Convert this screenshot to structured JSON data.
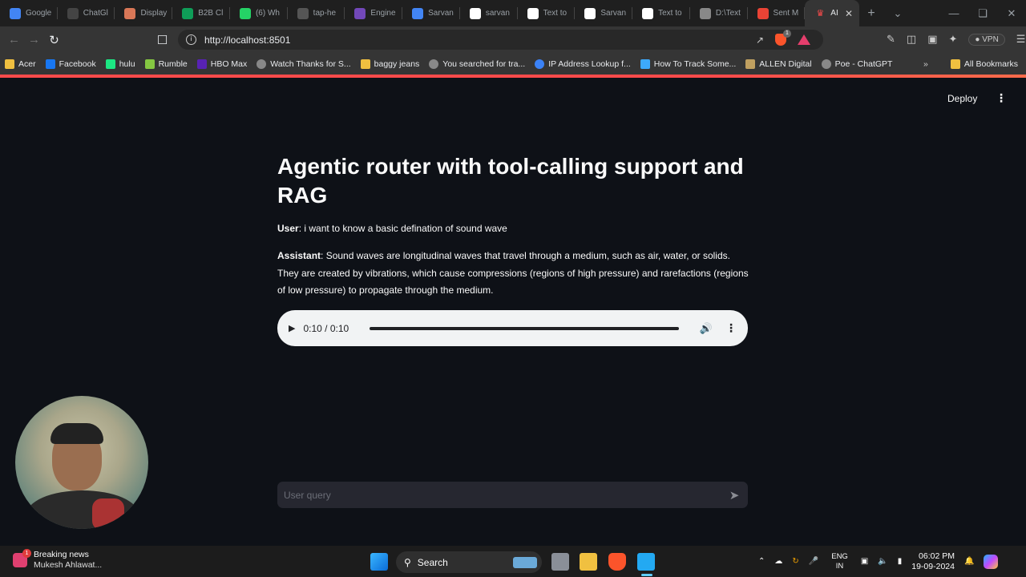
{
  "browser": {
    "tabs": [
      {
        "label": "Google",
        "icon": "google-icon",
        "color": "#4285f4"
      },
      {
        "label": "ChatGl",
        "icon": "chatgpt-icon",
        "color": "#444"
      },
      {
        "label": "Display",
        "icon": "claude-icon",
        "color": "#d97757"
      },
      {
        "label": "B2B Cl",
        "icon": "sheets-icon",
        "color": "#0f9d58"
      },
      {
        "label": "(6) Wh",
        "icon": "whatsapp-icon",
        "color": "#25d366"
      },
      {
        "label": "tap-he",
        "icon": "github-icon",
        "color": "#555"
      },
      {
        "label": "Engine",
        "icon": "forms-icon",
        "color": "#7248b9"
      },
      {
        "label": "Sarvan",
        "icon": "docs-icon",
        "color": "#4285f4"
      },
      {
        "label": "sarvan",
        "icon": "s-icon",
        "color": "#fff"
      },
      {
        "label": "Text to",
        "icon": "s-icon",
        "color": "#fff"
      },
      {
        "label": "Sarvan",
        "icon": "s-icon",
        "color": "#fff"
      },
      {
        "label": "Text to",
        "icon": "s-icon",
        "color": "#fff"
      },
      {
        "label": "D:\\Text",
        "icon": "globe-icon",
        "color": "#888"
      },
      {
        "label": "Sent M",
        "icon": "gmail-icon",
        "color": "#ea4335"
      }
    ],
    "active_tab": {
      "label": "AI",
      "icon": "streamlit-icon"
    },
    "new_tab_symbol": "+",
    "url": "http://localhost:8501",
    "vpn_label": "VPN",
    "shield_badge": "1",
    "bookmarks": [
      {
        "label": "Acer",
        "icon": "folder-icon",
        "color": "#f0c040"
      },
      {
        "label": "Facebook",
        "icon": "facebook-icon",
        "color": "#1877f2"
      },
      {
        "label": "hulu",
        "icon": "hulu-icon",
        "color": "#1ce783"
      },
      {
        "label": "Rumble",
        "icon": "rumble-icon",
        "color": "#85c742"
      },
      {
        "label": "HBO Max",
        "icon": "hbo-icon",
        "color": "#5822b4"
      },
      {
        "label": "Watch Thanks for S...",
        "icon": "globe-icon",
        "color": "#888"
      },
      {
        "label": "baggy jeans",
        "icon": "folder-icon",
        "color": "#f0c040"
      },
      {
        "label": "You searched for tra...",
        "icon": "globe-icon",
        "color": "#888"
      },
      {
        "label": "IP Address Lookup f...",
        "icon": "globe-icon",
        "color": "#3b82f6"
      },
      {
        "label": "How To Track Some...",
        "icon": "page-icon",
        "color": "#3da9fc"
      },
      {
        "label": "ALLEN Digital",
        "icon": "allen-icon",
        "color": "#c0a060"
      },
      {
        "label": "Poe - ChatGPT",
        "icon": "poe-icon",
        "color": "#888"
      }
    ],
    "all_bookmarks_label": "All Bookmarks"
  },
  "app": {
    "deploy_label": "Deploy",
    "menu_symbol": "⋮",
    "title": "Agentic router with tool-calling support and RAG",
    "messages": [
      {
        "role": "User",
        "text": ": i want to know a basic defination of sound wave"
      },
      {
        "role": "Assistant",
        "text": ": Sound waves are longitudinal waves that travel through a medium, such as air, water, or solids. They are created by vibrations, which cause compressions (regions of high pressure) and rarefactions (regions of low pressure) to propagate through the medium."
      }
    ],
    "audio": {
      "time": "0:10 / 0:10",
      "progress": 1.0
    },
    "input_placeholder": "User query"
  },
  "taskbar": {
    "news_title": "Breaking news",
    "news_subtitle": "Mukesh Ahlawat...",
    "news_badge": "1",
    "search_label": "Search",
    "lang_top": "ENG",
    "lang_bottom": "IN",
    "time": "06:02 PM",
    "date": "19-09-2024"
  }
}
